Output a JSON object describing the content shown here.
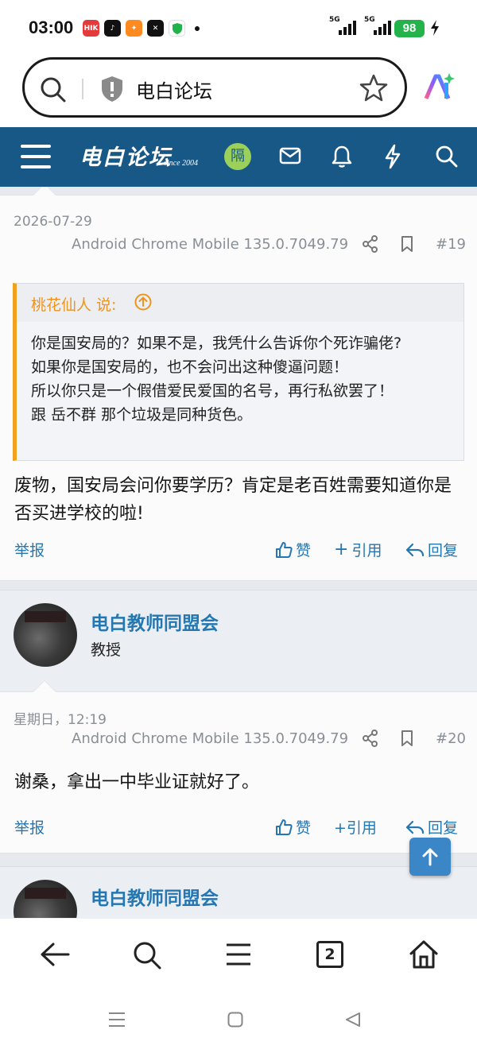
{
  "status": {
    "time": "03:00",
    "signal1": "5G",
    "signal2": "5G",
    "battery": "98"
  },
  "urlbar": {
    "text": "电白论坛"
  },
  "nav": {
    "logo": "电白论坛",
    "since": "since 2004",
    "badge": "隔"
  },
  "posts": [
    {
      "date": "2026-07-29",
      "device": "Android Chrome Mobile 135.0.7049.79",
      "number": "#19",
      "quote": {
        "author": "桃花仙人 说:",
        "lines": [
          "你是国安局的？如果不是，我凭什么告诉你个死诈骗佬?",
          "如果你是国安局的，也不会问出这种傻逼问题！",
          "所以你只是一个假借爱民爱国的名号，再行私欲罢了！",
          "跟 岳不群 那个垃圾是同种货色。"
        ]
      },
      "text": "废物，国安局会问你要学历？肯定是老百姓需要知道你是否买进学校的啦!",
      "actions": {
        "report": "举报",
        "like": "赞",
        "quote": "引用",
        "reply": "回复"
      }
    },
    {
      "user": {
        "name": "电白教师同盟会",
        "title": "教授"
      },
      "date": "星期日，12:19",
      "device": "Android Chrome Mobile 135.0.7049.79",
      "number": "#20",
      "text": "谢桑，拿出一中毕业证就好了。",
      "actions": {
        "report": "举报",
        "like": "赞",
        "quote": "+引用",
        "reply": "回复"
      }
    },
    {
      "user": {
        "name": "电白教师同盟会"
      }
    }
  ],
  "bottom": {
    "tabs": "2"
  },
  "colors": {
    "nav_bg": "#185886",
    "link": "#2577b1",
    "quote_accent": "#f0a11e",
    "battery": "#23b34a"
  }
}
